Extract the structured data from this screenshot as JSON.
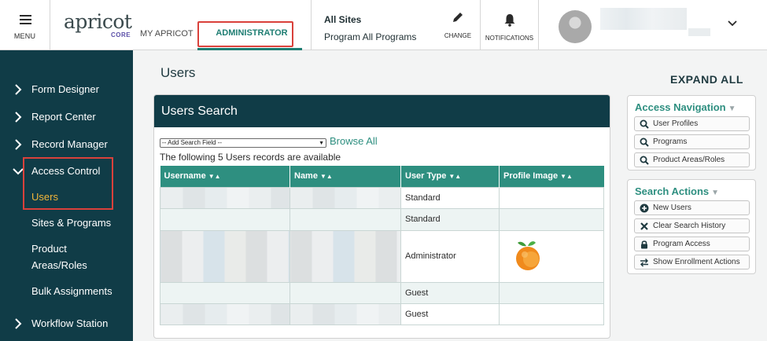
{
  "header": {
    "menu_label": "MENU",
    "logo_word": "apricot",
    "logo_sub": "CORE",
    "nav": {
      "my_apricot": "MY APRICOT",
      "administrator": "ADMINISTRATOR"
    },
    "sites_title": "All Sites",
    "sites_program": "Program All Programs",
    "change_label": "CHANGE",
    "notifications_label": "NOTIFICATIONS",
    "accent_color": "#1e7d72",
    "highlight_color": "#d9413b"
  },
  "sidebar": {
    "items": [
      {
        "label": "Form Designer",
        "icon": "chevron-right-icon"
      },
      {
        "label": "Report Center",
        "icon": "chevron-right-icon"
      },
      {
        "label": "Record Manager",
        "icon": "chevron-right-icon"
      },
      {
        "label": "Access Control",
        "icon": "chevron-down-icon"
      },
      {
        "label": "Workflow Station",
        "icon": "chevron-right-icon"
      }
    ],
    "sub_items": [
      "Users",
      "Sites & Programs",
      "Product Areas/Roles",
      "Bulk Assignments"
    ],
    "active_sub": "Users",
    "background": "#103c47",
    "active_color": "#f0b53a"
  },
  "main": {
    "page_title": "Users",
    "expand_all": "EXPAND ALL",
    "search_panel_title": "Users Search",
    "add_field_select": "-- Add Search Field --",
    "browse_all": "Browse All",
    "records_note": "The following 5 Users records are available",
    "table": {
      "columns": [
        "Username",
        "Name",
        "User Type",
        "Profile Image"
      ],
      "rows": [
        {
          "user_type": "Standard",
          "profile_image": ""
        },
        {
          "user_type": "Standard",
          "profile_image": ""
        },
        {
          "user_type": "Administrator",
          "profile_image": "apricot-fruit-icon"
        },
        {
          "user_type": "Guest",
          "profile_image": ""
        },
        {
          "user_type": "Guest",
          "profile_image": ""
        }
      ]
    }
  },
  "access_navigation": {
    "title": "Access Navigation",
    "buttons": [
      {
        "label": "User Profiles",
        "icon": "search-icon"
      },
      {
        "label": "Programs",
        "icon": "search-icon"
      },
      {
        "label": "Product Areas/Roles",
        "icon": "search-icon"
      }
    ]
  },
  "search_actions": {
    "title": "Search Actions",
    "buttons": [
      {
        "label": "New Users",
        "icon": "plus-circle-icon"
      },
      {
        "label": "Clear Search History",
        "icon": "x-icon"
      },
      {
        "label": "Program Access",
        "icon": "lock-icon"
      },
      {
        "label": "Show Enrollment Actions",
        "icon": "swap-arrows-icon"
      }
    ]
  }
}
